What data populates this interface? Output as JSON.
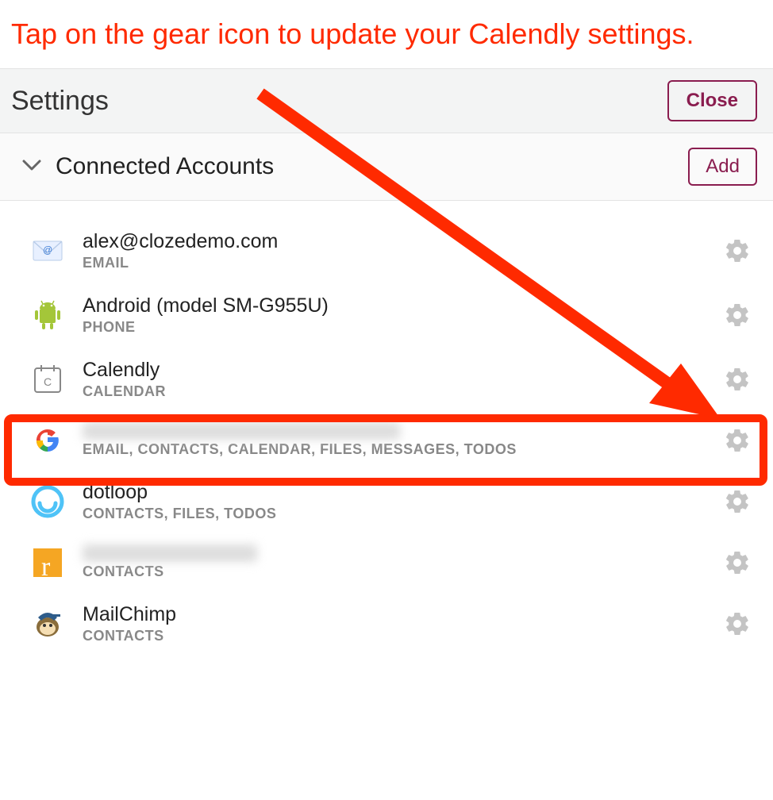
{
  "instruction": "Tap on the gear icon to update your Calendly settings.",
  "header": {
    "title": "Settings",
    "close_label": "Close"
  },
  "section": {
    "title": "Connected Accounts",
    "add_label": "Add"
  },
  "accounts": [
    {
      "name": "alex@clozedemo.com",
      "sub": "EMAIL",
      "icon": "envelope"
    },
    {
      "name": "Android (model SM-G955U)",
      "sub": "PHONE",
      "icon": "android"
    },
    {
      "name": "Calendly",
      "sub": "CALENDAR",
      "icon": "calendly"
    },
    {
      "name": "",
      "sub": "EMAIL, CONTACTS, CALENDAR, FILES, MESSAGES, TODOS",
      "icon": "google",
      "blurred": true
    },
    {
      "name": "dotloop",
      "sub": "CONTACTS, FILES, TODOS",
      "icon": "dotloop"
    },
    {
      "name": "",
      "sub": "CONTACTS",
      "icon": "realtor",
      "blurred": true
    },
    {
      "name": "MailChimp",
      "sub": "CONTACTS",
      "icon": "mailchimp"
    }
  ],
  "colors": {
    "accent": "#FF2A00",
    "brand": "#8a1d4f"
  }
}
